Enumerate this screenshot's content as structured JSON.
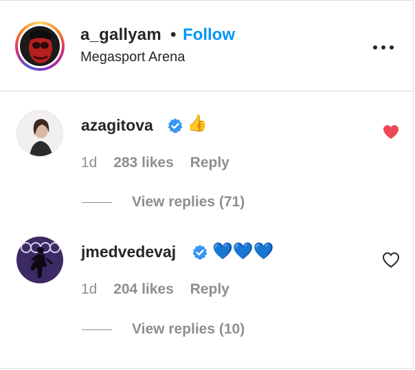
{
  "header": {
    "username": "a_gallyam",
    "separator": "•",
    "follow_label": "Follow",
    "location": "Megasport Arena",
    "more_icon": "more-horizontal-icon"
  },
  "comments": [
    {
      "username": "azagitova",
      "verified": true,
      "text": "👍",
      "age": "1d",
      "likes": "283 likes",
      "reply_label": "Reply",
      "view_replies": "View replies (71)",
      "liked": true
    },
    {
      "username": "jmedvedevaj",
      "verified": true,
      "text": "💙💙💙",
      "age": "1d",
      "likes": "204 likes",
      "reply_label": "Reply",
      "view_replies": "View replies (10)",
      "liked": false
    }
  ],
  "colors": {
    "follow": "#0095f6",
    "liked_heart": "#ed4956",
    "verified": "#3897f0",
    "muted_text": "#8e8e8e"
  }
}
